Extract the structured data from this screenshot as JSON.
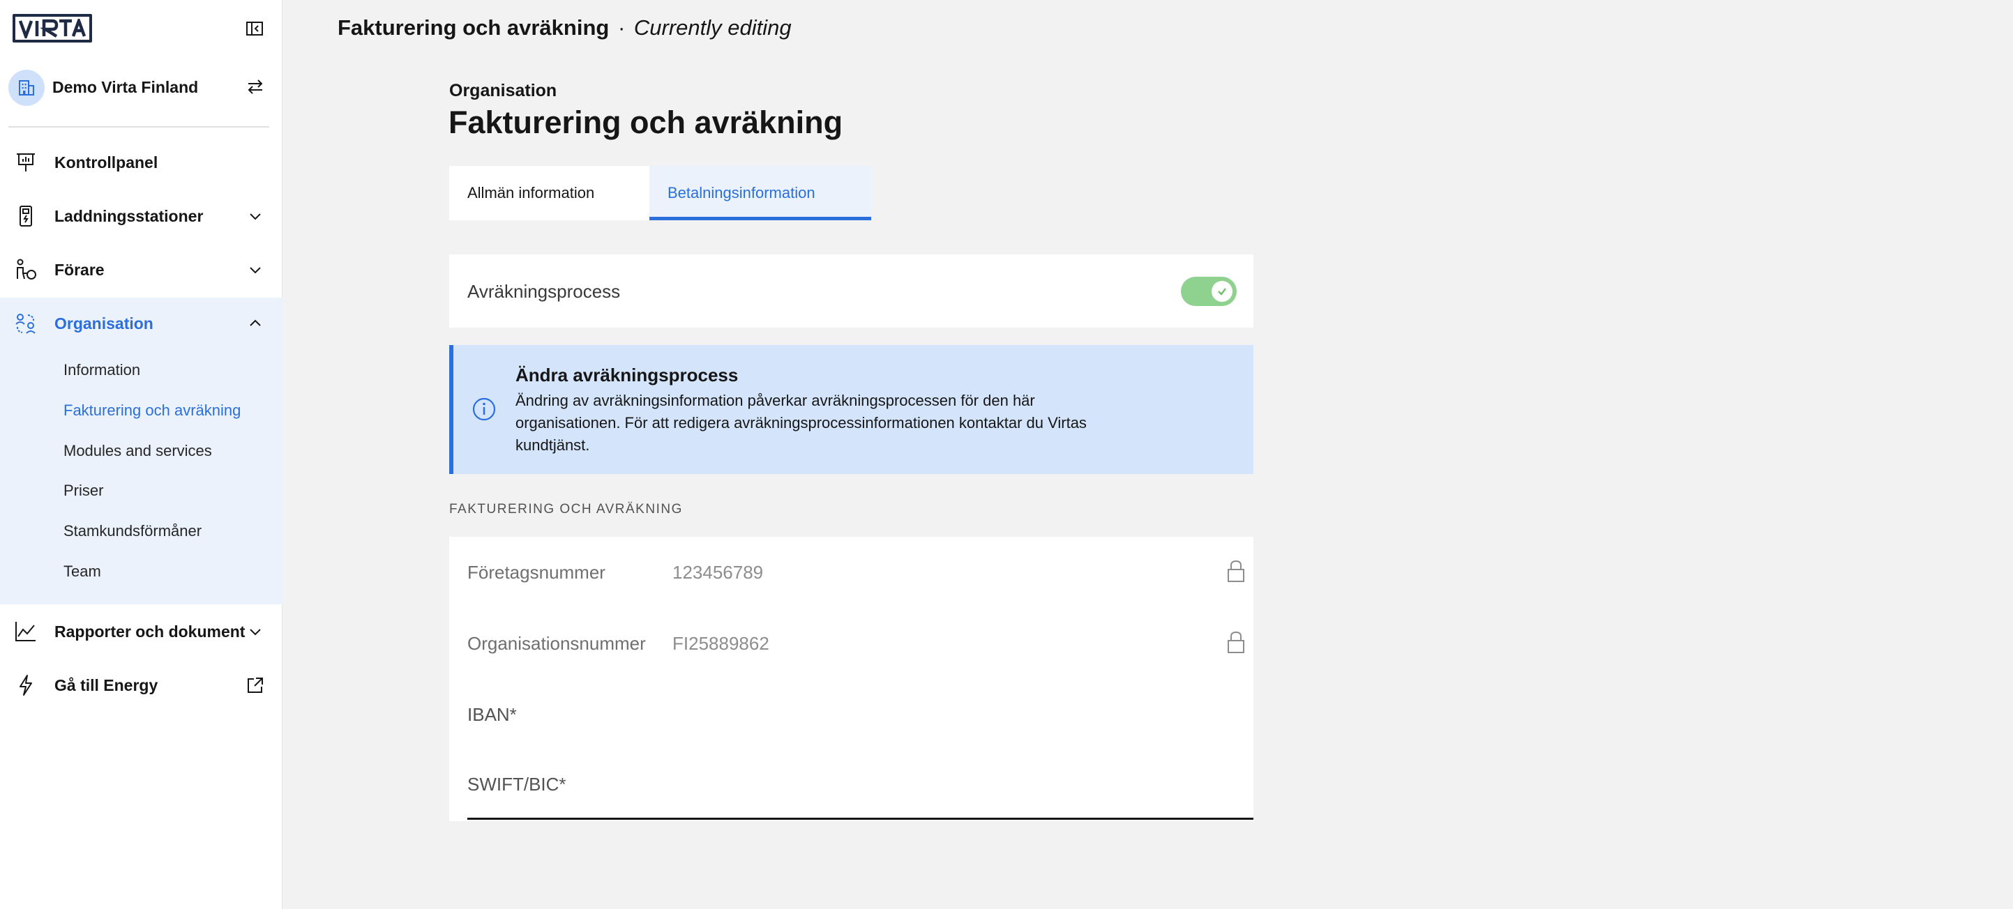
{
  "sidebar": {
    "logo_text": "VIRTA",
    "org_name": "Demo Virta Finland",
    "nav": {
      "dashboard": "Kontrollpanel",
      "stations": "Laddningsstationer",
      "drivers": "Förare",
      "organisation": "Organisation",
      "reports": "Rapporter och dokument",
      "energy": "Gå till Energy"
    },
    "sub_items": [
      "Information",
      "Fakturering och avräkning",
      "Modules and services",
      "Priser",
      "Stamkundsförmåner",
      "Team"
    ]
  },
  "header": {
    "title": "Fakturering och avräkning",
    "separator": "·",
    "status": "Currently editing"
  },
  "main": {
    "eyebrow": "Organisation",
    "title": "Fakturering och avräkning",
    "tabs": [
      "Allmän information",
      "Betalningsinformation"
    ],
    "active_tab": "Betalningsinformation",
    "toggle_label": "Avräkningsprocess",
    "toggle_on": true,
    "notice": {
      "title": "Ändra avräkningsprocess",
      "text": "Ändring av avräkningsinformation påverkar avräkningsprocessen för den här organisationen. För att redigera avräkningsprocessinformationen kontaktar du Virtas kundtjänst."
    },
    "section_label": "FAKTURERING OCH AVRÄKNING",
    "fields": {
      "company_number_label": "Företagsnummer",
      "company_number_value": "123456789",
      "org_number_label": "Organisationsnummer",
      "org_number_value": "FI25889862",
      "iban_label": "IBAN*",
      "swift_label": "SWIFT/BIC*"
    }
  },
  "colors": {
    "accent": "#2a6fdb",
    "toggle_on": "#8fd18f",
    "notice_bg": "#d4e4fb",
    "active_nav_bg": "#ebf2fc"
  }
}
